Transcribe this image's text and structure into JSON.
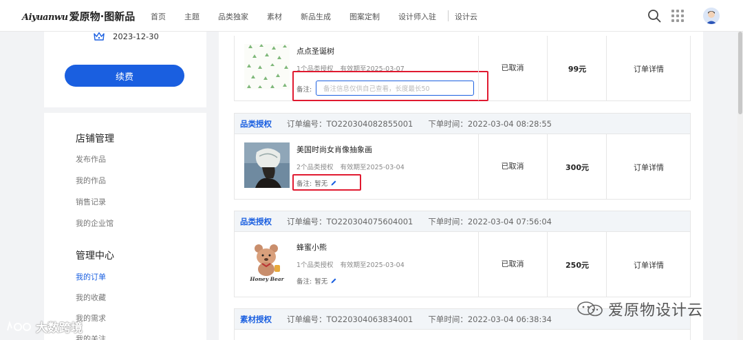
{
  "header": {
    "logo_latin": "Aiyuanwu",
    "logo_cn": "爱原物·图新品",
    "nav": [
      "首页",
      "主题",
      "品类独家",
      "素材",
      "新品生成",
      "图案定制",
      "设计师入驻",
      "设计云"
    ]
  },
  "sidebar": {
    "date": "2023-12-30",
    "renew_label": "续费",
    "section1_title": "店铺管理",
    "section1_links": [
      "发布作品",
      "我的作品",
      "销售记录",
      "我的企业馆"
    ],
    "section2_title": "管理中心",
    "section2_links": [
      "我的订单",
      "我的收藏",
      "我的需求",
      "我的关注"
    ]
  },
  "orders": [
    {
      "title": "点点圣诞树",
      "license_count": "1个品类授权",
      "validity": "有效期至2025-03-07",
      "note_label": "备注:",
      "note_placeholder": "备注信息仅供自己查看，长度最长50",
      "status": "已取消",
      "price": "99元",
      "detail": "订单详情"
    },
    {
      "type": "品类授权",
      "order_no": "订单编号：TO220304082855001",
      "order_time": "下单时间：2022-03-04 08:28:55",
      "title": "美国时尚女肖像抽象画",
      "license_count": "2个品类授权",
      "validity": "有效期至2025-03-04",
      "note_label": "备注:",
      "note_value": "暂无",
      "status": "已取消",
      "price": "300元",
      "detail": "订单详情"
    },
    {
      "type": "品类授权",
      "order_no": "订单编号：TO220304075604001",
      "order_time": "下单时间：2022-03-04 07:56:04",
      "title": "蜂蜜小熊",
      "thumb_caption": "Honey Bear",
      "license_count": "1个品类授权",
      "validity": "有效期至2025-03-04",
      "note_label": "备注:",
      "note_value": "暂无",
      "status": "已取消",
      "price": "250元",
      "detail": "订单详情"
    },
    {
      "type": "素材授权",
      "order_no": "订单编号：TO220304063834001",
      "order_time": "下单时间：2022-03-04 06:38:34"
    }
  ],
  "watermarks": {
    "brand": "爱原物设计云",
    "corner": "大数跨境"
  },
  "colors": {
    "accent": "#1a5fe0",
    "highlight": "#e0192f"
  }
}
